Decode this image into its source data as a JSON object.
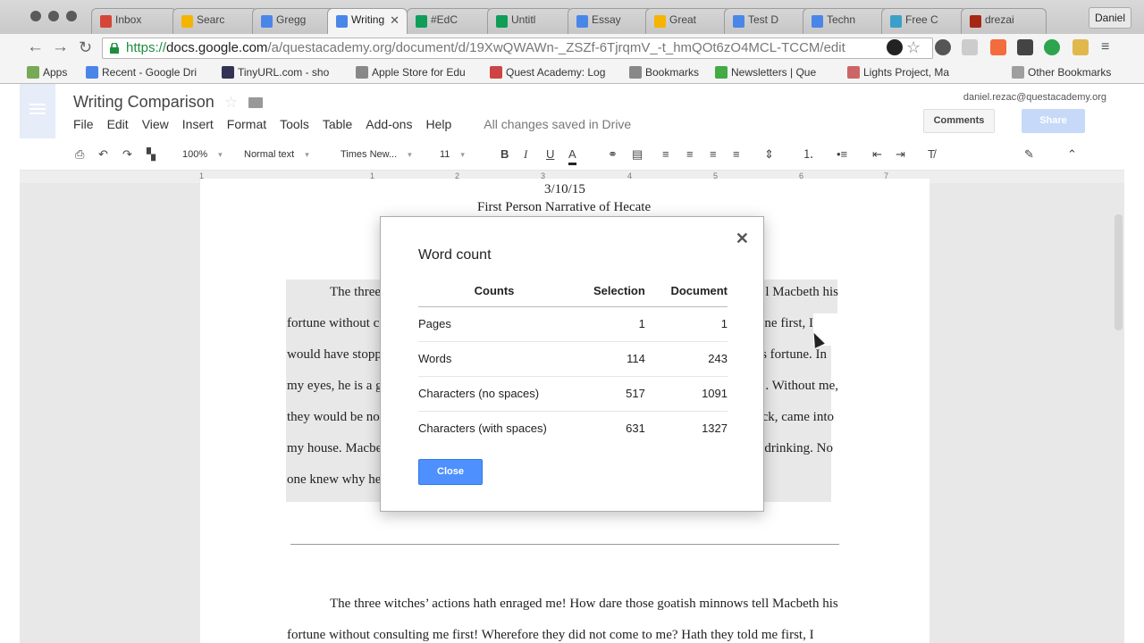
{
  "browser": {
    "tabs": [
      {
        "label": "Inbox",
        "color": "#d44638"
      },
      {
        "label": "Searc",
        "color": "#f4b400"
      },
      {
        "label": "Gregg",
        "color": "#4a86e8"
      },
      {
        "label": "Writing",
        "color": "#4a86e8"
      },
      {
        "label": "#EdC",
        "color": "#0f9d58"
      },
      {
        "label": "Untitl",
        "color": "#0f9d58"
      },
      {
        "label": "Essay",
        "color": "#4a86e8"
      },
      {
        "label": "Great",
        "color": "#f4b400"
      },
      {
        "label": "Test D",
        "color": "#4a86e8"
      },
      {
        "label": "Techn",
        "color": "#4a86e8"
      },
      {
        "label": "Free C",
        "color": "#3aa0c8"
      },
      {
        "label": "drezai",
        "color": "#a52714"
      }
    ],
    "profile": "Daniel",
    "url_prefix": "https://",
    "url_host": "docs.google.com",
    "url_path": "/a/questacademy.org/document/d/19XwQWAWn-_ZSZf-6TjrqmV_-t_hmQOt6zO4MCL-TCCM/edit",
    "bookmarks": [
      "Apps",
      "Recent - Google Dri",
      "TinyURL.com - sho",
      "Apple Store for Edu",
      "Quest Academy: Log",
      "Bookmarks",
      "Newsletters | Que",
      "Lights Project, Ma"
    ],
    "other_bookmarks": "Other Bookmarks"
  },
  "docs": {
    "title": "Writing Comparison",
    "menu": [
      "File",
      "Edit",
      "View",
      "Insert",
      "Format",
      "Tools",
      "Table",
      "Add-ons",
      "Help"
    ],
    "saved_status": "All changes saved in Drive",
    "account": "daniel.rezac@questacademy.org",
    "comments_label": "Comments",
    "share_label": "Share",
    "zoom": "100%",
    "style": "Normal text",
    "font": "Times New...",
    "font_size": "11",
    "ruler": [
      "1",
      "1",
      "2",
      "3",
      "4",
      "5",
      "6",
      "7"
    ]
  },
  "document": {
    "date": "3/10/15",
    "heading": "First Person Narrative of Hecate",
    "left_fragments": [
      "The three",
      "fortune without c",
      "would have stopp",
      "my eyes, he is a g",
      "they would be no",
      "my house. Macbe",
      "one knew why he"
    ],
    "right_fragments": [
      "l Macbeth his",
      "ne first, I",
      "s fortune. In",
      ". Without me,",
      "ck, came into",
      "drinking. No"
    ],
    "lower_lines": [
      "The three witches’ actions hath enraged me! How dare those goatish minnows tell Macbeth his",
      "fortune without consulting me first! Wherefore they did not come to me? Hath they told me first, I"
    ]
  },
  "word_count": {
    "title": "Word count",
    "headers": [
      "Counts",
      "Selection",
      "Document"
    ],
    "rows": [
      [
        "Pages",
        "1",
        "1"
      ],
      [
        "Words",
        "114",
        "243"
      ],
      [
        "Characters (no spaces)",
        "517",
        "1091"
      ],
      [
        "Characters (with spaces)",
        "631",
        "1327"
      ]
    ],
    "close_label": "Close"
  }
}
